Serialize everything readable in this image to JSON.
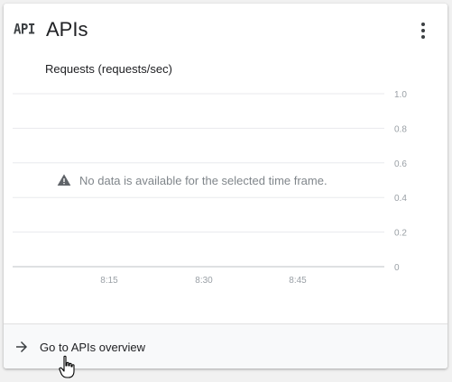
{
  "card": {
    "icon_text": "API",
    "title": "APIs",
    "menu_icon": "more-vert-icon"
  },
  "chart": {
    "title": "Requests (requests/sec)",
    "no_data_message": "No data is available for the selected time frame.",
    "no_data_icon": "warning-icon"
  },
  "chart_data": {
    "type": "line",
    "title": "Requests (requests/sec)",
    "xlabel": "",
    "ylabel": "",
    "x_ticks": [
      "8:15",
      "8:30",
      "8:45"
    ],
    "y_ticks": [
      "1.0",
      "0.8",
      "0.6",
      "0.4",
      "0.2",
      "0"
    ],
    "ylim": [
      0,
      1.0
    ],
    "series": [],
    "grid": true,
    "y_axis_position": "right"
  },
  "footer": {
    "icon": "arrow-right-icon",
    "label": "Go to APIs overview"
  },
  "colors": {
    "grid": "#e8eaed",
    "text_secondary": "#9aa0a6",
    "warning": "#5f6368"
  }
}
